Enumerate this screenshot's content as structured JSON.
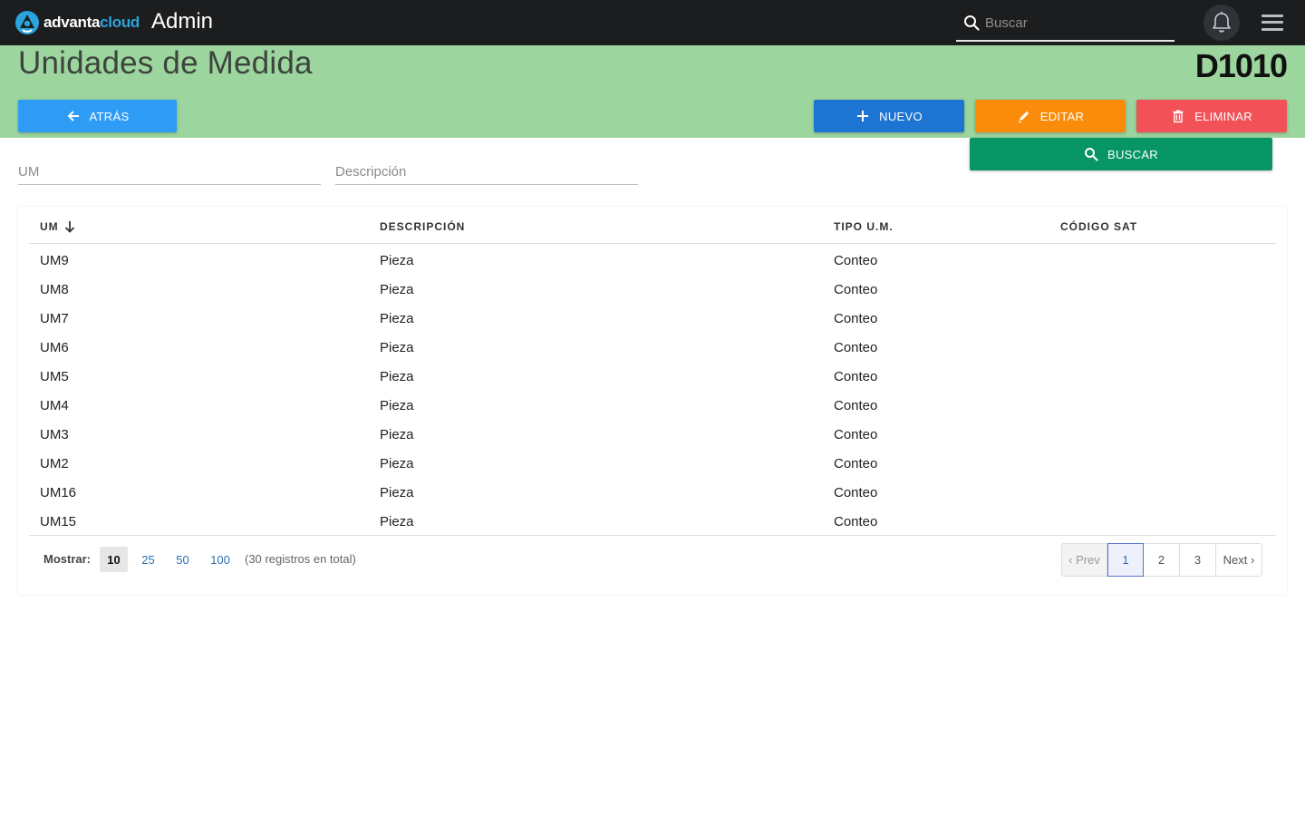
{
  "topbar": {
    "logo_part1": "advanta",
    "logo_part2": "cloud",
    "app_title": "Admin",
    "search_placeholder": "Buscar"
  },
  "header": {
    "title": "Unidades de Medida",
    "code": "D1010",
    "buttons": {
      "back": "ATRÁS",
      "new": "NUEVO",
      "edit": "EDITAR",
      "delete": "ELIMINAR",
      "search": "BUSCAR"
    }
  },
  "filters": {
    "um_placeholder": "UM",
    "desc_placeholder": "Descripción"
  },
  "table": {
    "columns": [
      "UM",
      "DESCRIPCIÓN",
      "TIPO U.M.",
      "CÓDIGO SAT"
    ],
    "rows": [
      [
        "UM9",
        "Pieza",
        "Conteo",
        ""
      ],
      [
        "UM8",
        "Pieza",
        "Conteo",
        ""
      ],
      [
        "UM7",
        "Pieza",
        "Conteo",
        ""
      ],
      [
        "UM6",
        "Pieza",
        "Conteo",
        ""
      ],
      [
        "UM5",
        "Pieza",
        "Conteo",
        ""
      ],
      [
        "UM4",
        "Pieza",
        "Conteo",
        ""
      ],
      [
        "UM3",
        "Pieza",
        "Conteo",
        ""
      ],
      [
        "UM2",
        "Pieza",
        "Conteo",
        ""
      ],
      [
        "UM16",
        "Pieza",
        "Conteo",
        ""
      ],
      [
        "UM15",
        "Pieza",
        "Conteo",
        ""
      ]
    ]
  },
  "footer": {
    "show_label": "Mostrar:",
    "page_sizes": [
      "10",
      "25",
      "50",
      "100"
    ],
    "selected_size": "10",
    "total": "(30 registros en total)",
    "prev": "‹ Prev",
    "pages": [
      "1",
      "2",
      "3"
    ],
    "current_page": "1",
    "next": "Next ›"
  },
  "colors": {
    "topbar": "#1c1d1f",
    "header_bg": "#9cd59e",
    "back": "#2e9cf5",
    "new": "#1e74d2",
    "edit": "#fb8c0b",
    "delete": "#f25158",
    "search": "#079566"
  }
}
